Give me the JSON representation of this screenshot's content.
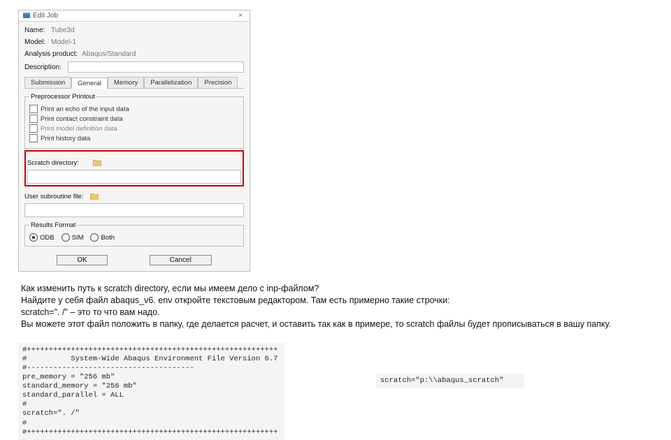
{
  "dialog": {
    "title": "Edit Job",
    "close": "×",
    "name_label": "Name:",
    "name_value": "Tube3d",
    "model_label": "Model:",
    "model_value": "Model-1",
    "analysis_label": "Analysis product:",
    "analysis_value": "Abaqus/Standard",
    "desc_label": "Description:"
  },
  "tabs": {
    "items": [
      "Submission",
      "General",
      "Memory",
      "Parallelization",
      "Precision"
    ]
  },
  "preproc": {
    "legend": "Preprocessor Printout",
    "items": [
      "Print an echo of the input data",
      "Print contact constraint data",
      "Print model definition data",
      "Print history data"
    ]
  },
  "scratch": {
    "label": "Scratch directory:"
  },
  "usersub": {
    "label": "User subroutine file:"
  },
  "results": {
    "legend": "Results Format",
    "odb": "ODB",
    "sim": "SIM",
    "both": "Both"
  },
  "buttons": {
    "ok": "OK",
    "cancel": "Cancel"
  },
  "para": {
    "l1": "Как изменить путь к scratch directory, если мы имеем дело с inp-файлом?",
    "l2": "Найдите у себя файл abaqus_v6. env  откройте текстовым редактором. Там есть примерно такие строчки:",
    "l3": "scratch=\". /\" – это то что вам надо.",
    "l4": "Вы можете этот файл положить в папку, где делается расчет, и оставить так как в примере, то scratch файлы будет прописываться в вашу папку."
  },
  "codeA": "#+++++++++++++++++++++++++++++++++++++++++++++++++++++++++\n#          System-Wide Abaqus Environment File Version 6.7\n#--------------------------------------\npre_memory = \"256 mb\"\nstandard_memory = \"256 mb\"\nstandard_parallel = ALL\n#\nscratch=\". /\"\n#\n#+++++++++++++++++++++++++++++++++++++++++++++++++++++++++",
  "codeB": "scratch=\"p:\\\\abaqus_scratch\""
}
